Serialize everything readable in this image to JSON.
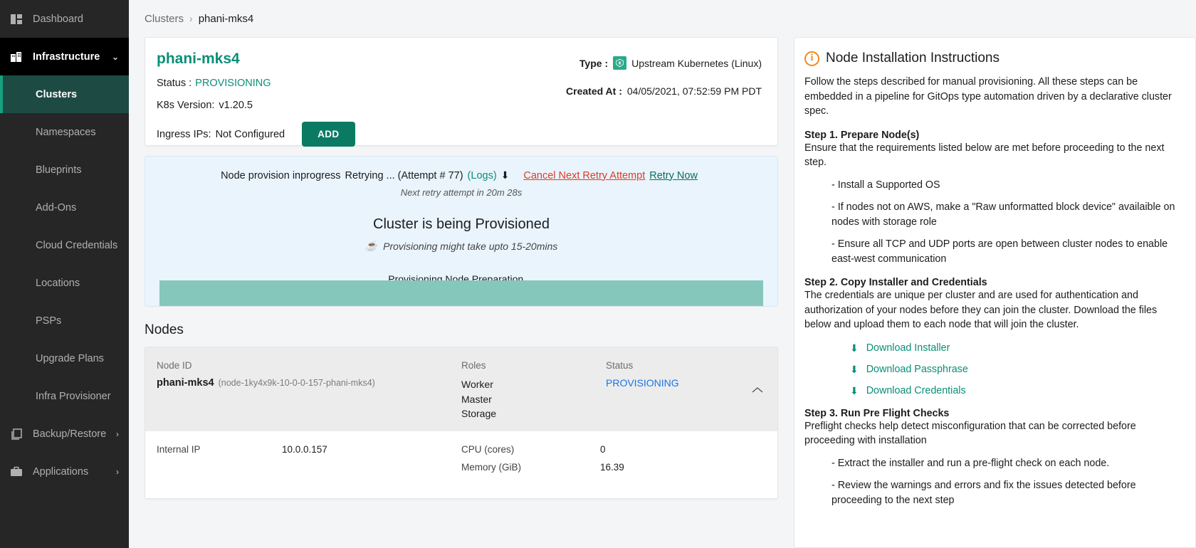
{
  "sidebar": {
    "items": [
      {
        "label": "Dashboard",
        "icon": "dashboard-grid-icon",
        "type": "top"
      },
      {
        "label": "Infrastructure",
        "icon": "building-icon",
        "type": "group",
        "caret": "⌄"
      },
      {
        "label": "Clusters",
        "type": "sub",
        "selected": true
      },
      {
        "label": "Namespaces",
        "type": "sub"
      },
      {
        "label": "Blueprints",
        "type": "sub"
      },
      {
        "label": "Add-Ons",
        "type": "sub"
      },
      {
        "label": "Cloud Credentials",
        "type": "sub"
      },
      {
        "label": "Locations",
        "type": "sub"
      },
      {
        "label": "PSPs",
        "type": "sub"
      },
      {
        "label": "Upgrade Plans",
        "type": "sub"
      },
      {
        "label": "Infra Provisioner",
        "type": "sub"
      },
      {
        "label": "Backup/Restore",
        "icon": "copy-icon",
        "type": "top",
        "caret": "›"
      },
      {
        "label": "Applications",
        "icon": "briefcase-icon",
        "type": "top",
        "caret": "›"
      }
    ]
  },
  "breadcrumb": {
    "parent": "Clusters",
    "separator": "›",
    "current": "phani-mks4"
  },
  "cluster": {
    "name": "phani-mks4",
    "status_label": "Status :",
    "status_value": "PROVISIONING",
    "k8s_label": "K8s Version:",
    "k8s_value": "v1.20.5",
    "ingress_label": "Ingress IPs:",
    "ingress_value": "Not Configured",
    "add_button": "ADD",
    "type_label": "Type :",
    "type_value": "Upstream Kubernetes (Linux)",
    "created_label": "Created At :",
    "created_value": "04/05/2021, 07:52:59 PM PDT"
  },
  "provision": {
    "message": "Node provision inprogress",
    "retry_text": "Retrying ... (Attempt # 77)",
    "logs_link": "(Logs)",
    "download_glyph": "⬇",
    "cancel_link": "Cancel Next Retry Attempt",
    "retry_link": "Retry Now",
    "next_retry": "Next retry attempt in 20m 28s",
    "headline": "Cluster is being Provisioned",
    "coffee_glyph": "☕",
    "subline": "Provisioning might take upto 15-20mins",
    "stage": "Provisioning Node Preparation ...",
    "progress_percent": 100,
    "progress_color": "#86c7bc"
  },
  "nodes": {
    "section_title": "Nodes",
    "columns": {
      "node_id": "Node ID",
      "roles": "Roles",
      "status": "Status"
    },
    "row": {
      "name": "phani-mks4",
      "id": "(node-1ky4x9k-10-0-0-157-phani-mks4)",
      "roles": [
        "Worker",
        "Master",
        "Storage"
      ],
      "status": "PROVISIONING",
      "collapse_glyph": "⌃"
    },
    "details": {
      "internal_ip_label": "Internal IP",
      "internal_ip_value": "10.0.0.157",
      "cpu_label": "CPU (cores)",
      "cpu_value": "0",
      "memory_label": "Memory (GiB)",
      "memory_value": "16.39"
    }
  },
  "instructions": {
    "title": "Node Installation Instructions",
    "info_glyph": "i",
    "intro": "Follow the steps described for manual provisioning. All these steps can be embedded in a pipeline for GitOps type automation driven by a declarative cluster spec.",
    "step1_heading": "Step 1. Prepare Node(s)",
    "step1_body": "Ensure that the requirements listed below are met before proceeding to the next step.",
    "step1_bullets": [
      "- Install a Supported OS",
      "- If nodes not on AWS, make a \"Raw unformatted block device\" availaible on nodes with storage role",
      "- Ensure all TCP and UDP ports are open between cluster nodes to enable east-west communication"
    ],
    "step2_heading": "Step 2. Copy Installer and Credentials",
    "step2_body": "The credentials are unique per cluster and are used for authentication and authorization of your nodes before they can join the cluster. Download the files below and upload them to each node that will join the cluster.",
    "downloads": [
      {
        "label": "Download Installer",
        "glyph": "⬇"
      },
      {
        "label": "Download Passphrase",
        "glyph": "⬇"
      },
      {
        "label": "Download Credentials",
        "glyph": "⬇"
      }
    ],
    "step3_heading": "Step 3. Run Pre Flight Checks",
    "step3_body": "Preflight checks help detect misconfiguration that can be corrected before proceeding with installation",
    "step3_bullets": [
      "- Extract the installer and run a pre-flight check on each node.",
      "- Review the warnings and errors and fix the issues detected before proceeding to the next step"
    ]
  },
  "colors": {
    "accent_green": "#0a8f78",
    "sidebar_bg": "#262626",
    "selected_nav": "#1d4b44",
    "status_blue": "#1a73e8",
    "danger_red": "#e03b24",
    "info_orange": "#f08a1d",
    "progress": "#86c7bc"
  }
}
